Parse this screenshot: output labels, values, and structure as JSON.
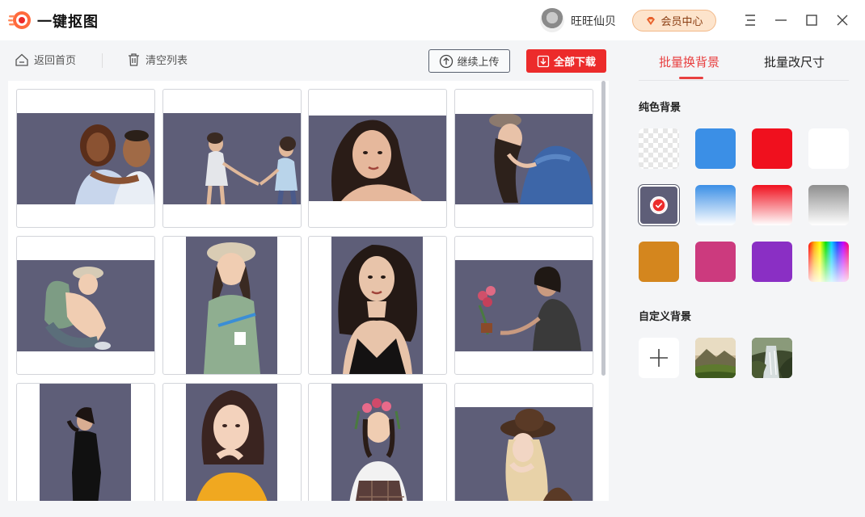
{
  "app": {
    "title": "一键抠图",
    "username": "旺旺仙贝",
    "vip_label": "会员中心"
  },
  "toolbar": {
    "back_label": "返回首页",
    "clear_label": "清空列表",
    "continue_label": "继续上传",
    "download_label": "全部下载"
  },
  "panel": {
    "tabs": [
      {
        "label": "批量换背景",
        "active": true
      },
      {
        "label": "批量改尺寸",
        "active": false
      }
    ],
    "solid_label": "纯色背景",
    "custom_label": "自定义背景",
    "swatches": [
      {
        "name": "transparent",
        "style": "checker"
      },
      {
        "name": "blue",
        "color": "#3b8fe6"
      },
      {
        "name": "red",
        "color": "#f0101e"
      },
      {
        "name": "white",
        "color": "#ffffff"
      },
      {
        "name": "slate",
        "color": "#5e5e78",
        "selected": true
      },
      {
        "name": "blue-gradient",
        "gradient": [
          "#3b8fe6",
          "#ffffff"
        ]
      },
      {
        "name": "red-gradient",
        "gradient": [
          "#f0101e",
          "#ffffff"
        ]
      },
      {
        "name": "gray-gradient",
        "gradient": [
          "#8e8e8e",
          "#ffffff"
        ]
      },
      {
        "name": "orange",
        "color": "#d4861e"
      },
      {
        "name": "magenta",
        "color": "#cc3a7e"
      },
      {
        "name": "purple",
        "color": "#8a2fc4"
      },
      {
        "name": "rainbow",
        "style": "rainbow"
      }
    ],
    "custom_items": [
      {
        "name": "add",
        "icon": "plus-icon"
      },
      {
        "name": "mountain-landscape"
      },
      {
        "name": "waterfall-landscape"
      }
    ]
  },
  "images": [
    {
      "name": "couple-hug",
      "shape": "landscape"
    },
    {
      "name": "dancing-pair",
      "shape": "landscape"
    },
    {
      "name": "woman-portrait",
      "shape": "landscape"
    },
    {
      "name": "woman-hat-denim",
      "shape": "landscape"
    },
    {
      "name": "girl-sitting-hat",
      "shape": "landscape"
    },
    {
      "name": "girl-hat-standing",
      "shape": "portrait"
    },
    {
      "name": "woman-black-dress",
      "shape": "portrait"
    },
    {
      "name": "woman-holding-flowers",
      "shape": "landscape"
    },
    {
      "name": "woman-black-gown",
      "shape": "portrait"
    },
    {
      "name": "woman-yellow-top",
      "shape": "portrait"
    },
    {
      "name": "girl-flower-crown",
      "shape": "portrait"
    },
    {
      "name": "woman-brown-hat",
      "shape": "portrait"
    }
  ],
  "colors": {
    "accent": "#e84040",
    "download_btn": "#ec2b2b",
    "image_bg": "#5e5e78"
  }
}
